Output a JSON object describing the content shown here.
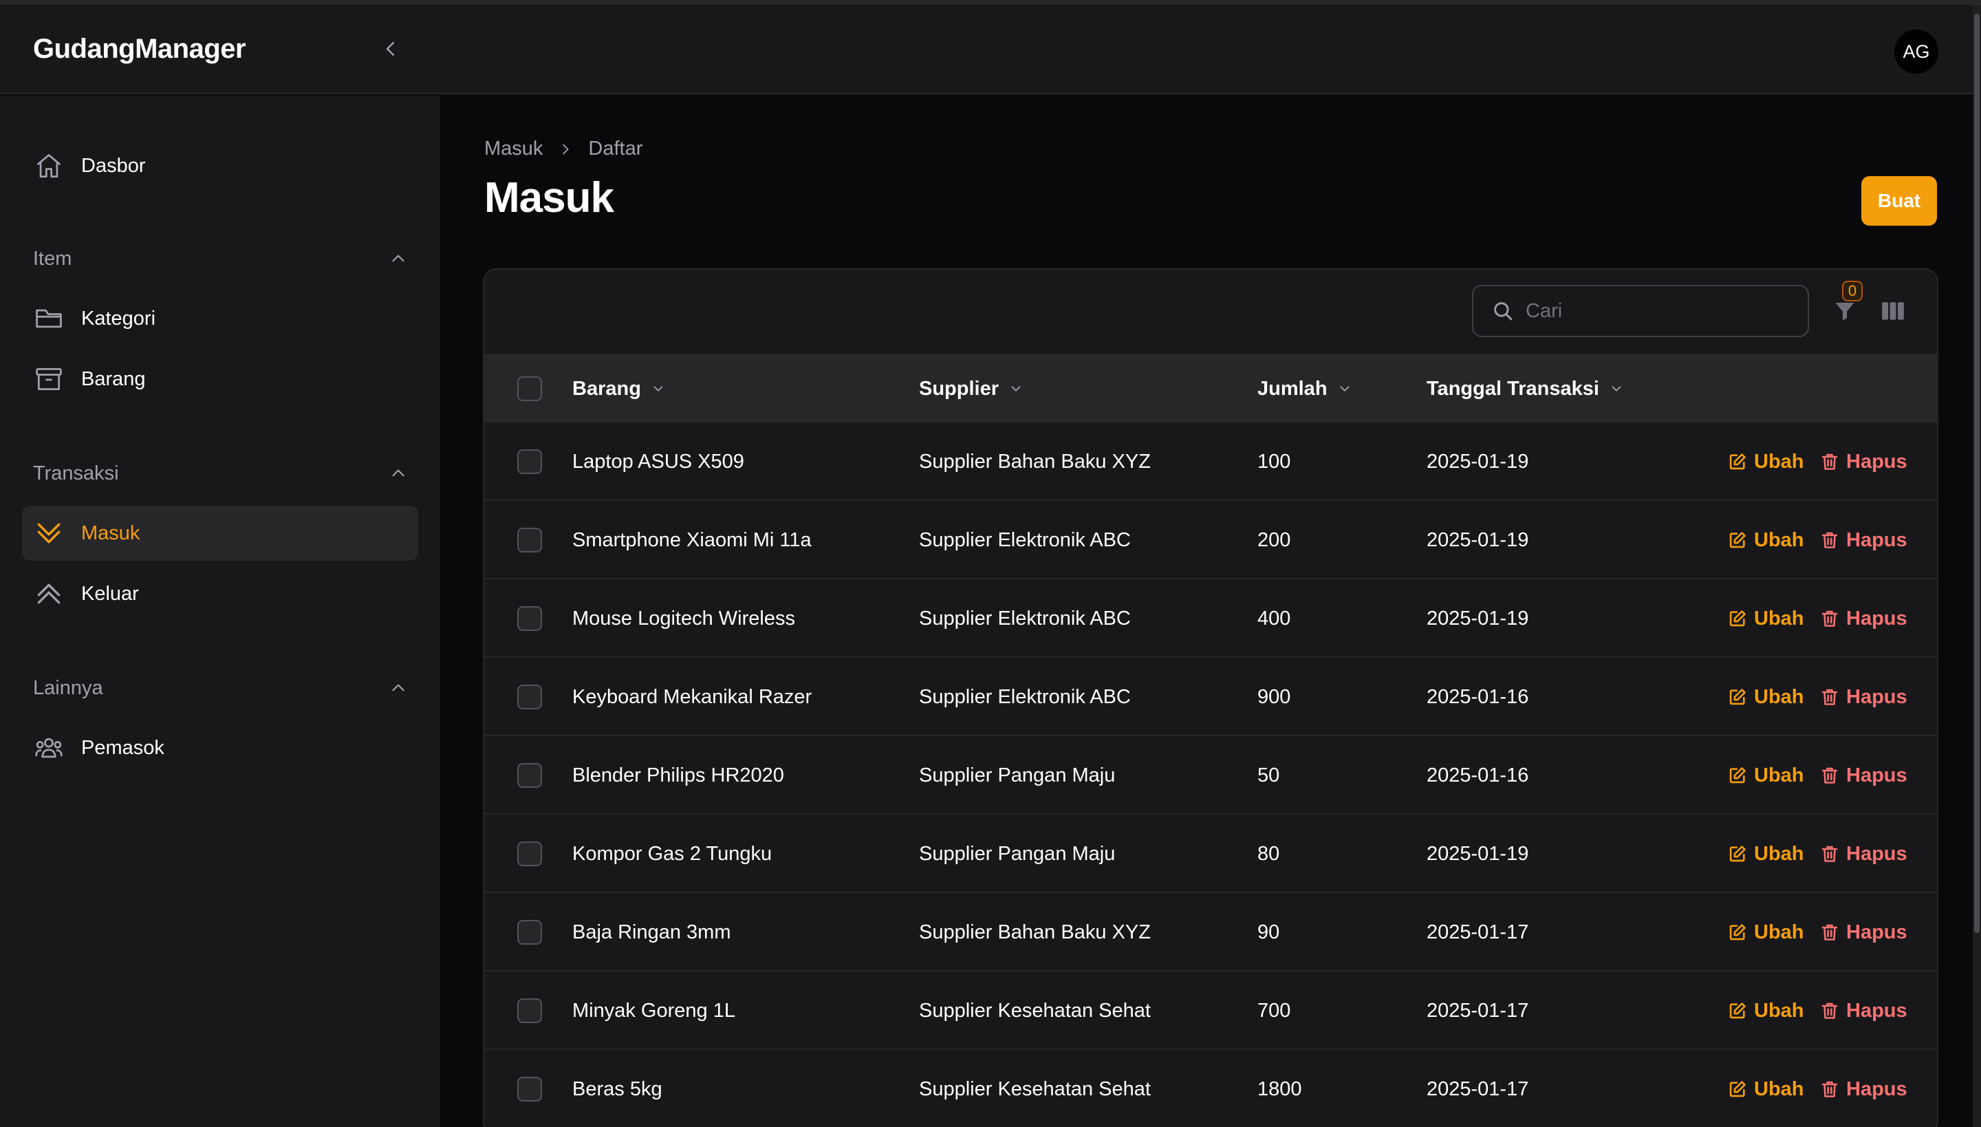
{
  "app": {
    "brand": "GudangManager",
    "user_initials": "AG"
  },
  "colors": {
    "accent": "#f59e0b",
    "danger": "#f87171",
    "background": "#09090b",
    "panel": "#18181b"
  },
  "sidebar": {
    "dashboard": {
      "label": "Dasbor",
      "icon": "home-icon"
    },
    "groups": [
      {
        "label": "Item",
        "items": [
          {
            "label": "Kategori",
            "icon": "folder-icon"
          },
          {
            "label": "Barang",
            "icon": "archive-box-icon"
          }
        ]
      },
      {
        "label": "Transaksi",
        "items": [
          {
            "label": "Masuk",
            "icon": "chevron-double-down-icon",
            "active": true
          },
          {
            "label": "Keluar",
            "icon": "chevron-double-up-icon"
          }
        ]
      },
      {
        "label": "Lainnya",
        "items": [
          {
            "label": "Pemasok",
            "icon": "user-group-icon"
          }
        ]
      }
    ]
  },
  "breadcrumb": [
    "Masuk",
    "Daftar"
  ],
  "page": {
    "title": "Masuk",
    "create_label": "Buat"
  },
  "table": {
    "search_placeholder": "Cari",
    "filter_count": "0",
    "columns": [
      "Barang",
      "Supplier",
      "Jumlah",
      "Tanggal Transaksi"
    ],
    "edit_label": "Ubah",
    "delete_label": "Hapus",
    "rows": [
      {
        "barang": "Laptop ASUS X509",
        "supplier": "Supplier Bahan Baku XYZ",
        "jumlah": "100",
        "tanggal": "2025-01-19"
      },
      {
        "barang": "Smartphone Xiaomi Mi 11a",
        "supplier": "Supplier Elektronik ABC",
        "jumlah": "200",
        "tanggal": "2025-01-19"
      },
      {
        "barang": "Mouse Logitech Wireless",
        "supplier": "Supplier Elektronik ABC",
        "jumlah": "400",
        "tanggal": "2025-01-19"
      },
      {
        "barang": "Keyboard Mekanikal Razer",
        "supplier": "Supplier Elektronik ABC",
        "jumlah": "900",
        "tanggal": "2025-01-16"
      },
      {
        "barang": "Blender Philips HR2020",
        "supplier": "Supplier Pangan Maju",
        "jumlah": "50",
        "tanggal": "2025-01-16"
      },
      {
        "barang": "Kompor Gas 2 Tungku",
        "supplier": "Supplier Pangan Maju",
        "jumlah": "80",
        "tanggal": "2025-01-19"
      },
      {
        "barang": "Baja Ringan 3mm",
        "supplier": "Supplier Bahan Baku XYZ",
        "jumlah": "90",
        "tanggal": "2025-01-17"
      },
      {
        "barang": "Minyak Goreng 1L",
        "supplier": "Supplier Kesehatan Sehat",
        "jumlah": "700",
        "tanggal": "2025-01-17"
      },
      {
        "barang": "Beras 5kg",
        "supplier": "Supplier Kesehatan Sehat",
        "jumlah": "1800",
        "tanggal": "2025-01-17"
      }
    ]
  }
}
